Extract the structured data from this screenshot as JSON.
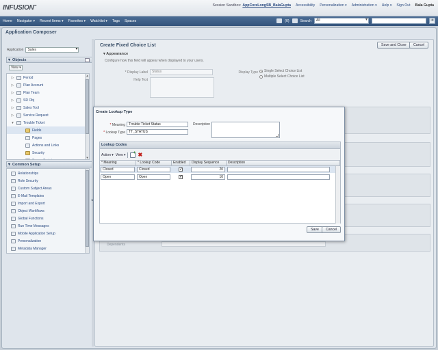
{
  "header": {
    "logo": "INFUSION",
    "logo_mark": "TM",
    "session_label": "Session Sandbox:",
    "session_name": "AppCoreLongSB_BalaGupta",
    "links": [
      "Accessibility",
      "Personalization ▾",
      "Administration ▾",
      "Help ▾",
      "Sign Out"
    ],
    "user": "Bala Gupta"
  },
  "nav": {
    "menus": [
      "Home",
      "Navigator ▾",
      "Recent Items ▾",
      "Favorites ▾",
      "Watchlist ▾",
      "Tags",
      "Spaces"
    ],
    "notif_count": "(0)",
    "search_label": "Search",
    "search_scope": "All",
    "search_go": "➔"
  },
  "app": {
    "title": "Application Composer",
    "application_label": "Application",
    "application_value": "Sales"
  },
  "objects": {
    "section_title": "Objects",
    "view_label": "View ▾",
    "items": [
      {
        "toggle": "▷",
        "label": "Period",
        "indent": 0,
        "icon": "object-icon"
      },
      {
        "toggle": "▷",
        "label": "Plan Account",
        "indent": 0,
        "icon": "object-icon"
      },
      {
        "toggle": "▷",
        "label": "Plan Team",
        "indent": 0,
        "icon": "object-icon"
      },
      {
        "toggle": "▷",
        "label": "SR Obj",
        "indent": 0,
        "icon": "object-icon"
      },
      {
        "toggle": "▷",
        "label": "Sales Tool",
        "indent": 0,
        "icon": "object-icon"
      },
      {
        "toggle": "▷",
        "label": "Service Request",
        "indent": 0,
        "icon": "object-icon"
      },
      {
        "toggle": "▾",
        "label": "Trouble Ticket",
        "indent": 0,
        "icon": "object-icon"
      },
      {
        "toggle": "",
        "label": "Fields",
        "indent": 1,
        "icon": "folder-icon",
        "selected": true
      },
      {
        "toggle": "",
        "label": "Pages",
        "indent": 1,
        "icon": "page-icon"
      },
      {
        "toggle": "",
        "label": "Actions and Links",
        "indent": 1,
        "icon": "link-icon"
      },
      {
        "toggle": "",
        "label": "Security",
        "indent": 1,
        "icon": "folder-icon"
      },
      {
        "toggle": "",
        "label": "Server Scripts",
        "indent": 1,
        "icon": "script-icon"
      }
    ]
  },
  "common_setup": {
    "section_title": "Common Setup",
    "items": [
      "Relationships",
      "Role Security",
      "Custom Subject Areas",
      "E-Mail Templates",
      "Import and Export",
      "Object Workflows",
      "Global Functions",
      "Run Time Messages",
      "Mobile Application Setup",
      "Personalization",
      "Metadata Manager"
    ]
  },
  "page": {
    "title": "Create Fixed Choice List",
    "save_close": "Save and Close",
    "cancel": "Cancel",
    "appearance_title": "Appearance",
    "appearance_desc": "Configure how this field will appear when displayed to your users.",
    "display_label_label": "* Display Label",
    "display_label_value": "Status",
    "help_text_label": "Help Text",
    "display_type_label": "Display Type",
    "display_type_options": [
      "Single Select Choice List",
      "Multiple Select Choice List"
    ],
    "bottom_text": "Dependents"
  },
  "modal": {
    "title": "Create Lookup Type",
    "meaning_label": "Meaning",
    "meaning_value": "Trouble Ticket Status",
    "lookup_type_label": "Lookup Type",
    "lookup_type_value": "TT_STATUS",
    "description_label": "Description",
    "codes_title": "Lookup Codes",
    "toolbar_action": "Action",
    "toolbar_view": "View",
    "columns": [
      "* Meaning",
      "* Lookup Code",
      "Enabled",
      "Display Sequence",
      "Description"
    ],
    "rows": [
      {
        "meaning": "Closed",
        "code": "Closed",
        "enabled": "✓",
        "sequence": "20",
        "description": ""
      },
      {
        "meaning": "Open",
        "code": "Open",
        "enabled": "✓",
        "sequence": "10",
        "description": ""
      }
    ],
    "save": "Save",
    "cancel": "Cancel"
  }
}
